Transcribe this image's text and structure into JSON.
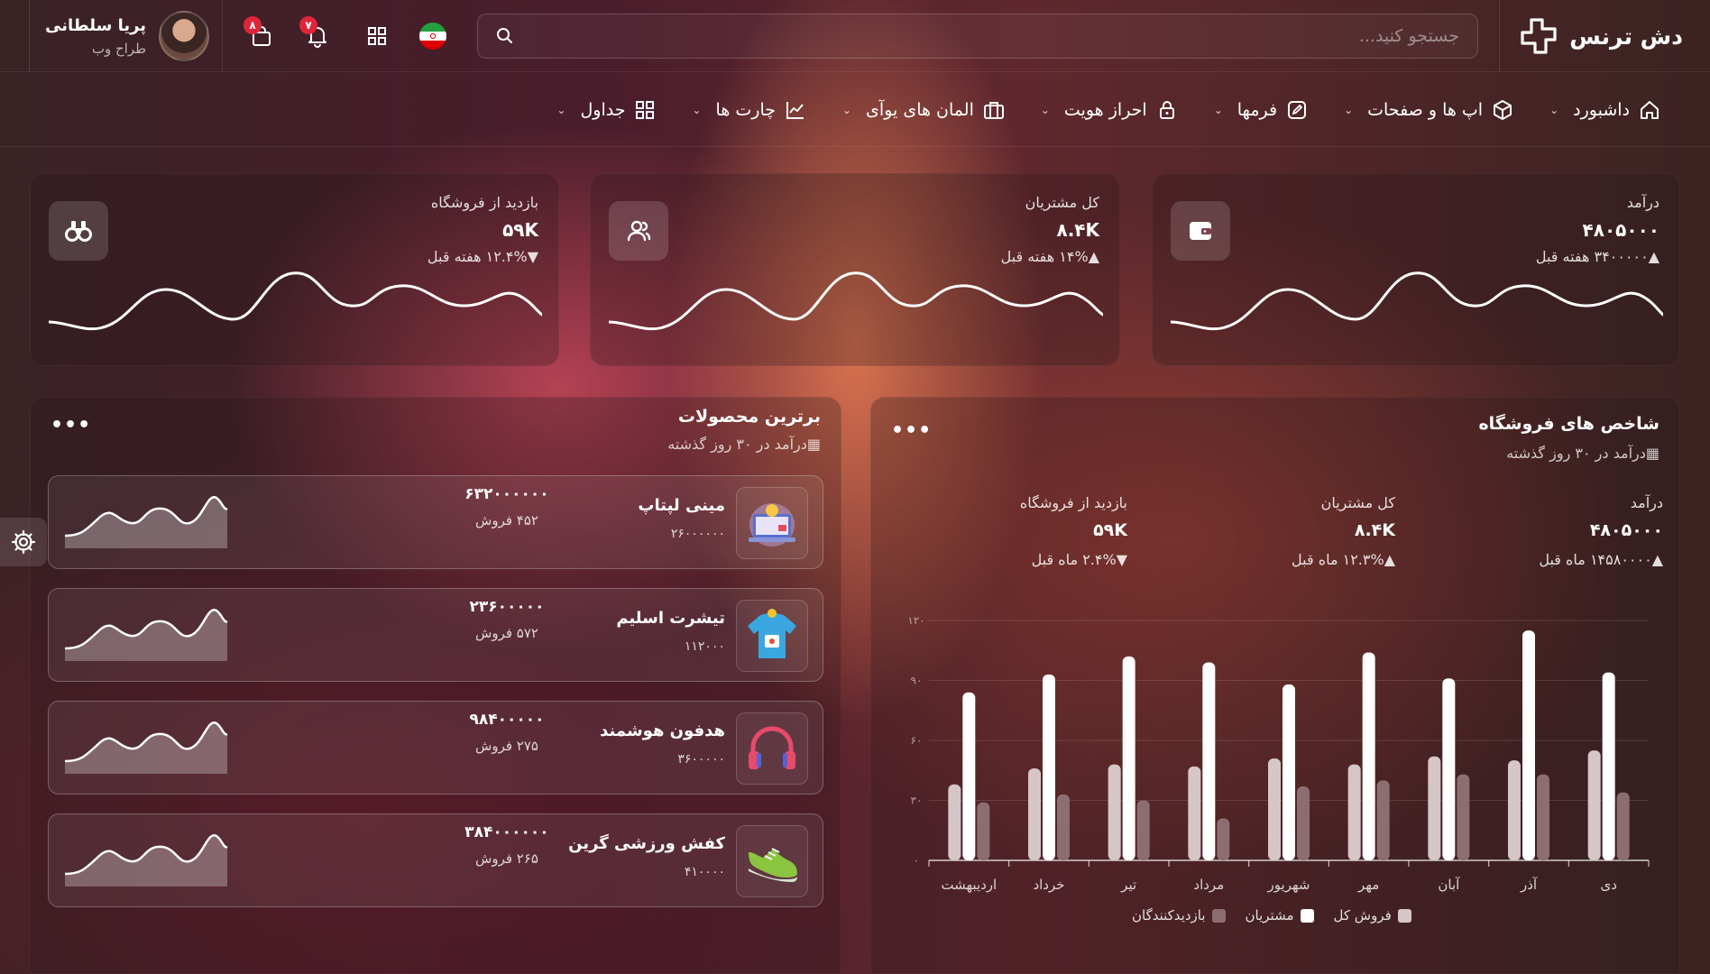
{
  "brand": {
    "name": "دش ترنس"
  },
  "search": {
    "placeholder": "جستجو کنید..."
  },
  "user": {
    "name": "پریا سلطانی",
    "role": "طراح وب"
  },
  "notifications": {
    "cart_count": "۸",
    "bell_count": "۷"
  },
  "menu": [
    {
      "label": "داشبورد",
      "icon": "home-icon"
    },
    {
      "label": "اپ ها و صفحات",
      "icon": "cube-icon"
    },
    {
      "label": "فرمها",
      "icon": "edit-icon"
    },
    {
      "label": "احراز هویت",
      "icon": "lock-icon"
    },
    {
      "label": "المان های یوآی",
      "icon": "briefcase-icon"
    },
    {
      "label": "چارت ها",
      "icon": "chart-icon"
    },
    {
      "label": "جداول",
      "icon": "grid-icon"
    }
  ],
  "stats": [
    {
      "label": "درآمد",
      "value": "۴۸۰۵۰۰۰",
      "change": "۳۴۰۰۰۰۰ هفته قبل",
      "trend": "up",
      "icon": "wallet-icon"
    },
    {
      "label": "کل مشتریان",
      "value": "۸.۴K",
      "change": "۱۴% هفته قبل",
      "trend": "up",
      "icon": "users-icon"
    },
    {
      "label": "بازدید از فروشگاه",
      "value": "۵۹K",
      "change": "۱۲.۴% هفته قبل",
      "trend": "down",
      "icon": "binoculars-icon"
    }
  ],
  "store_kpis": {
    "title": "شاخص های فروشگاه",
    "subtitle": "درآمد در ۳۰ روز گذشته",
    "items": [
      {
        "label": "درآمد",
        "value": "۴۸۰۵۰۰۰",
        "change": "۱۴۵۸۰۰۰۰ ماه قبل",
        "trend": "up"
      },
      {
        "label": "کل مشتریان",
        "value": "۸.۴K",
        "change": "۱۲.۳% ماه قبل",
        "trend": "up"
      },
      {
        "label": "بازدید از فروشگاه",
        "value": "۵۹K",
        "change": "۲.۴% ماه قبل",
        "trend": "down"
      }
    ]
  },
  "top_products": {
    "title": "برترین محصولات",
    "subtitle": "درآمد در ۳۰ روز گذشته",
    "items": [
      {
        "name": "مینی لپتاپ",
        "price": "۲۶۰۰۰۰۰۰",
        "total": "۶۳۲۰۰۰۰۰۰",
        "sales": "۴۵۲ فروش",
        "icon": "laptop-icon"
      },
      {
        "name": "تیشرت اسلیم",
        "price": "۱۱۲۰۰۰",
        "total": "۲۳۶۰۰۰۰۰",
        "sales": "۵۷۲ فروش",
        "icon": "tshirt-icon"
      },
      {
        "name": "هدفون هوشمند",
        "price": "۳۶۰۰۰۰۰",
        "total": "۹۸۴۰۰۰۰۰",
        "sales": "۲۷۵ فروش",
        "icon": "headphones-icon"
      },
      {
        "name": "کفش ورزشی گرین",
        "price": "۴۱۰۰۰۰",
        "total": "۳۸۴۰۰۰۰۰۰",
        "sales": "۲۶۵ فروش",
        "icon": "sneaker-icon"
      }
    ]
  },
  "chart_data": {
    "type": "bar",
    "categories": [
      "اردیبهشت",
      "خرداد",
      "تیر",
      "مرداد",
      "شهریور",
      "مهر",
      "آبان",
      "آذر",
      "دی"
    ],
    "series": [
      {
        "name": "فروش کل",
        "color": "#d7c6c7",
        "values": [
          38,
          46,
          48,
          47,
          51,
          48,
          52,
          50,
          55
        ]
      },
      {
        "name": "مشتریان",
        "color": "#ffffff",
        "values": [
          84,
          93,
          102,
          99,
          88,
          104,
          91,
          115,
          94
        ]
      },
      {
        "name": "بازدیدکنندگان",
        "color": "#8c6e72",
        "values": [
          29,
          33,
          30,
          21,
          37,
          40,
          43,
          43,
          34
        ]
      }
    ],
    "yticks": [
      "۰",
      "۳۰",
      "۶۰",
      "۹۰",
      "۱۲۰"
    ],
    "ylim": [
      0,
      120
    ],
    "grid": true,
    "legend": "bottom"
  }
}
